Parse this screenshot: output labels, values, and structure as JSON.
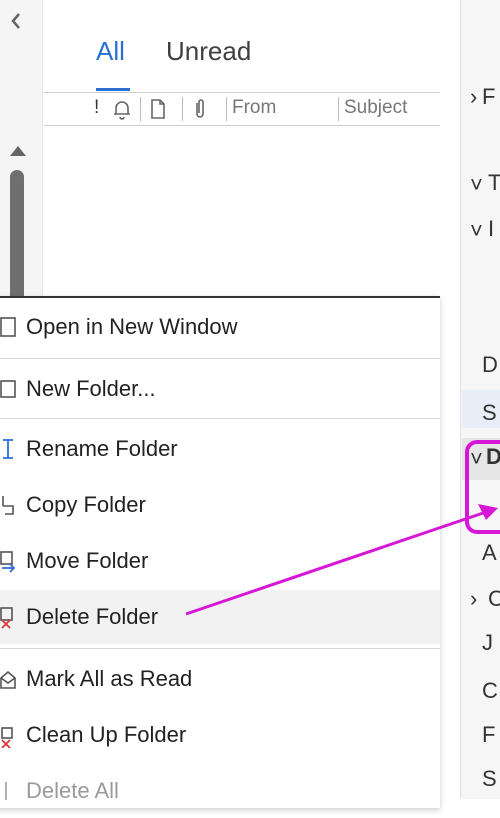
{
  "list_header": {
    "tabs": [
      {
        "label": "All"
      },
      {
        "label": "Unread"
      }
    ],
    "columns": [
      "!",
      "From",
      "Subject"
    ]
  },
  "context_menu": {
    "items": [
      {
        "label": "Open in New Window",
        "enabled": true
      },
      {
        "label": "New Folder...",
        "enabled": true
      },
      {
        "label": "Rename Folder",
        "enabled": true
      },
      {
        "label": "Copy Folder",
        "enabled": true
      },
      {
        "label": "Move Folder",
        "enabled": true
      },
      {
        "label": "Delete Folder",
        "enabled": true,
        "highlighted": true
      },
      {
        "label": "Mark All as Read",
        "enabled": true
      },
      {
        "label": "Clean Up Folder",
        "enabled": true
      },
      {
        "label": "Delete All",
        "enabled": false
      }
    ]
  },
  "right_panel_items": [
    "F",
    "T",
    "I",
    "D",
    "S",
    "D",
    "A",
    "C",
    "J",
    "C",
    "F",
    "S"
  ],
  "annotation": {
    "color": "#d617d6"
  }
}
